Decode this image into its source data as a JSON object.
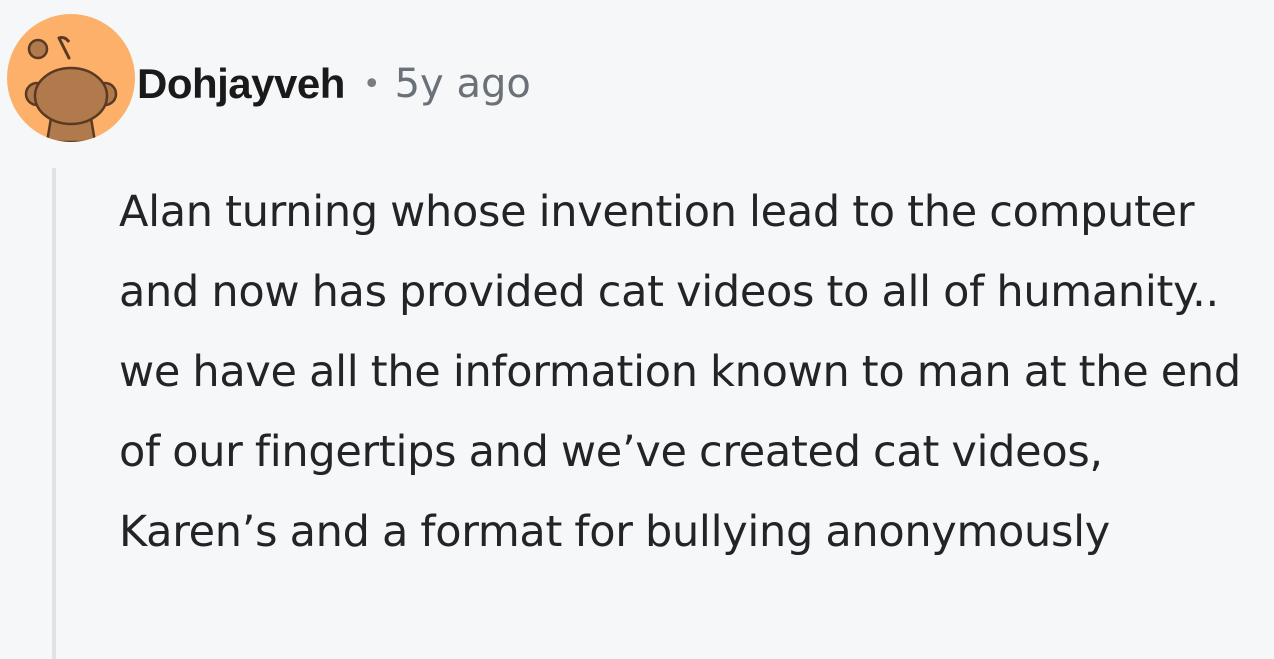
{
  "comment": {
    "author": "Dohjayveh",
    "separator": "•",
    "age": "5y ago",
    "avatar_icon": "reddit-snoo-avatar-icon",
    "avatar_color": "#fcb06a",
    "text": "Alan turning whose invention lead to the computer and now has provided cat videos to all of humanity.. we have all the information known to man at the end of our fingertips and we’ve created cat videos, Karen’s and a format for bullying anonymously"
  }
}
